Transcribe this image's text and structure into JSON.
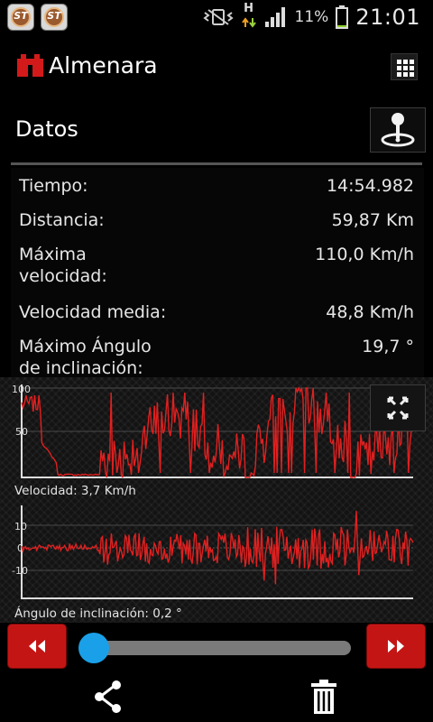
{
  "statusbar": {
    "clock": "21:01",
    "battery_percent": "11%",
    "network_letter": "H",
    "app_icons": [
      "ST",
      "ST"
    ],
    "icons": [
      "speedtracker-app-icon",
      "speedtracker-app-icon",
      "vibrate-icon",
      "data-transfer-icon",
      "signal-icon",
      "battery-icon"
    ],
    "battery_level": 0.11
  },
  "header": {
    "title": "Almenara",
    "logo_icon": "castle-icon",
    "menu_icon": "grid-icon"
  },
  "section": {
    "title": "Datos",
    "map_icon": "map-pin-icon"
  },
  "stats": [
    {
      "label": "Tiempo:",
      "value": "14:54.982"
    },
    {
      "label": "Distancia:",
      "value": "59,87  Km"
    },
    {
      "label": "Máxima velocidad:",
      "value": "110,0  Km/h"
    },
    {
      "label": "Velocidad media:",
      "value": "48,8  Km/h"
    },
    {
      "label": "Máximo Ángulo de inclinación:",
      "value": "19,7 °"
    }
  ],
  "speed_chart": {
    "y_ticks": [
      "100",
      "50"
    ],
    "caption": "Velocidad: 3,7  Km/h",
    "color": "#e02020"
  },
  "lean_chart": {
    "y_ticks": [
      "10",
      "0",
      "-10"
    ],
    "caption": "Ángulo de inclinación: 0,2 °",
    "color": "#e02020"
  },
  "playback": {
    "rewind_icon": "rewind-icon",
    "forward_icon": "fast-forward-icon",
    "progress": 0.02,
    "accent": "#1aa0e8",
    "button_color": "#c41515"
  },
  "bottombar": {
    "share_icon": "share-icon",
    "delete_icon": "trash-icon"
  }
}
